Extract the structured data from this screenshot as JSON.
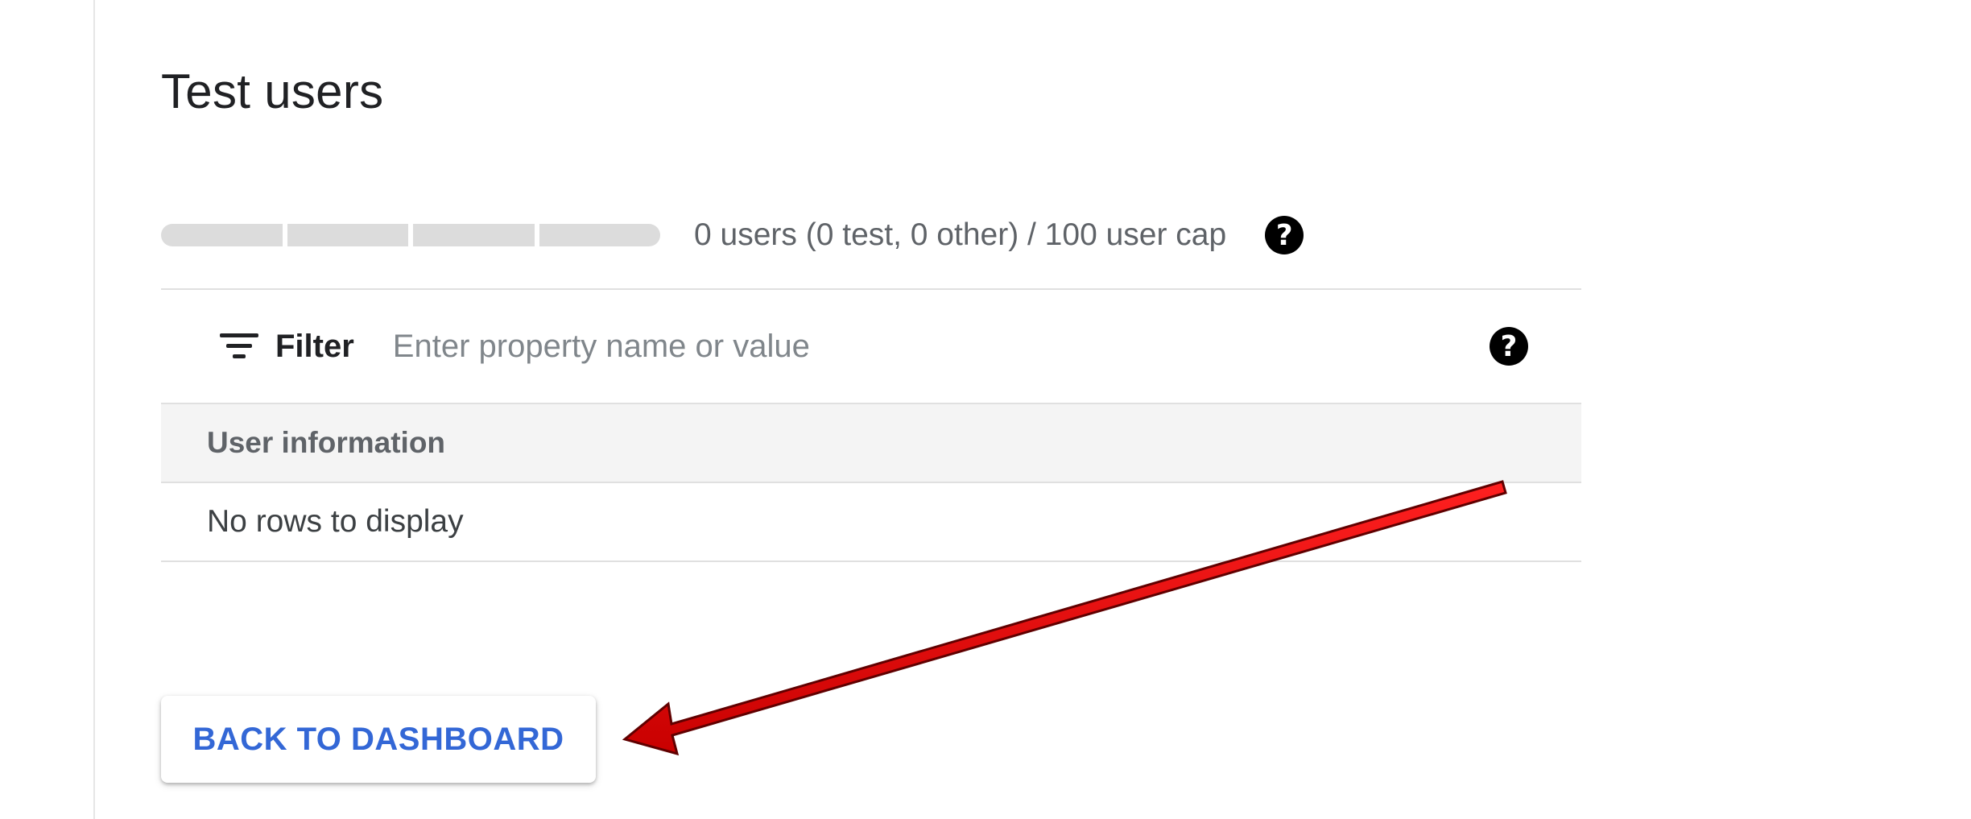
{
  "page_title": "Test users",
  "user_cap": {
    "segments": 4,
    "fill_fraction": 0,
    "summary": "0 users (0 test, 0 other) / 100 user cap",
    "help_icon": "help-circle-icon"
  },
  "filter": {
    "icon": "filter-list-icon",
    "label": "Filter",
    "placeholder": "Enter property name or value",
    "value": "",
    "help_icon": "help-circle-icon"
  },
  "table": {
    "columns": [
      "User information"
    ],
    "empty_message": "No rows to display"
  },
  "back_button": {
    "label": "BACK TO DASHBOARD"
  },
  "annotation": {
    "type": "arrow",
    "color": "#e00000",
    "points_to": "back_button"
  },
  "colors": {
    "accent": "#3367d6",
    "annotation_red": "#e00000"
  }
}
